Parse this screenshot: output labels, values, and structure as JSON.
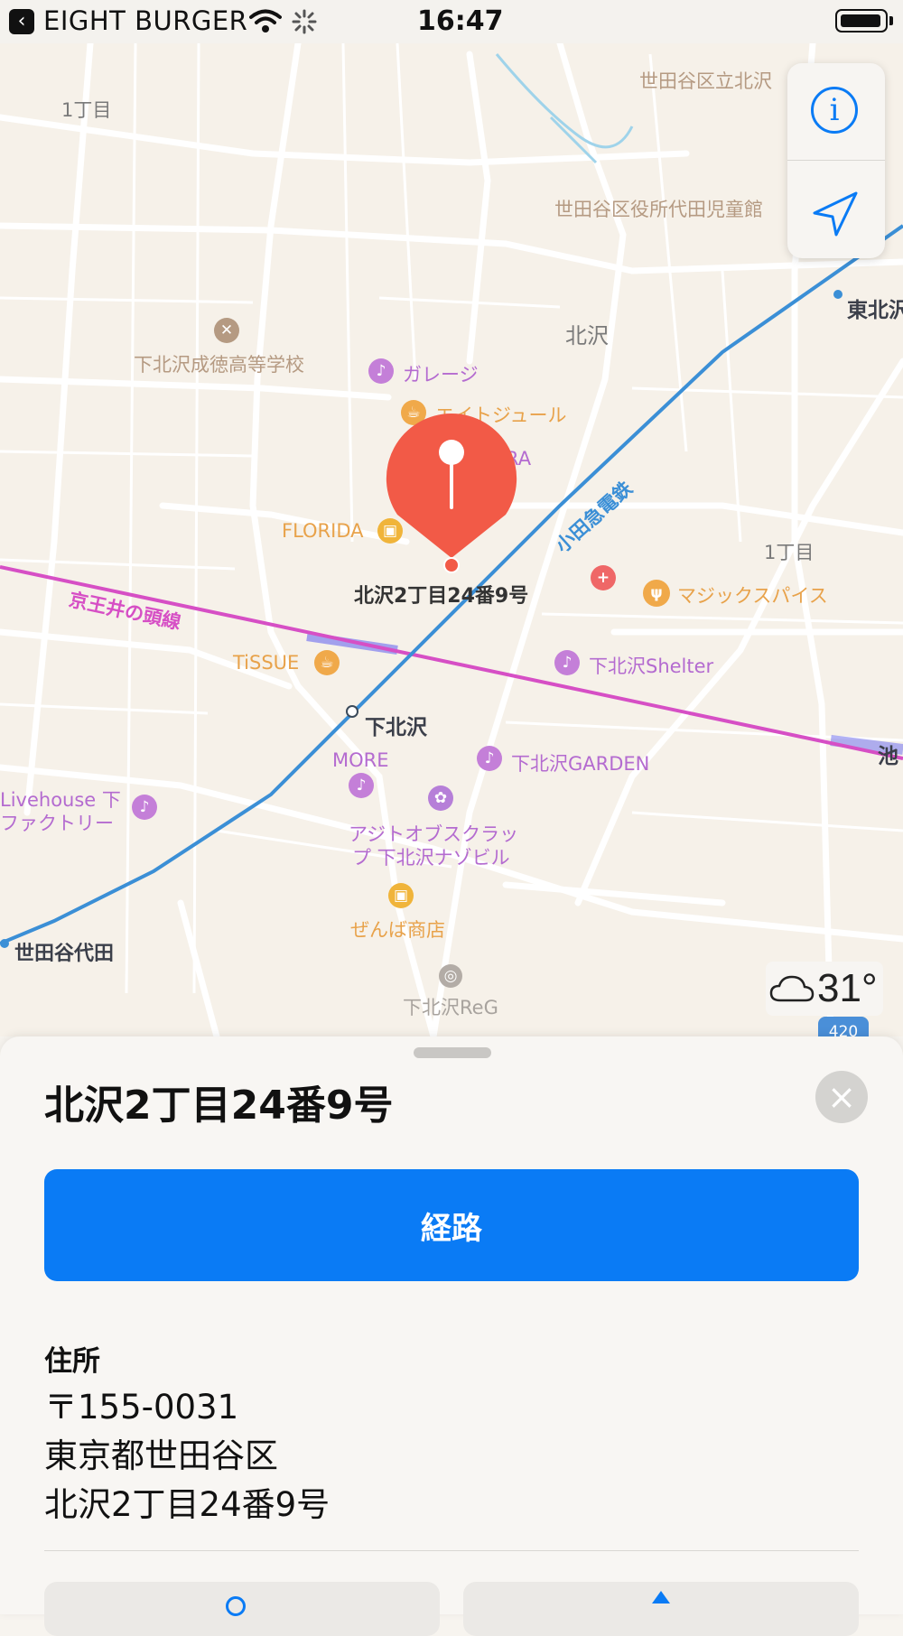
{
  "status_bar": {
    "back_app": "EIGHT BURGER",
    "time": "16:47"
  },
  "map": {
    "labels": {
      "block_1chome_left": "1丁目",
      "block_1chome_right": "1丁目",
      "school_top": "世田谷区立北沢",
      "children_hall": "世田谷区役所代田児童館",
      "kitazawa": "北沢",
      "higashikitazawa": "東北沢",
      "seitoku": "下北沢成徳高等学校",
      "garage": "ガレージ",
      "eightjour": "エイトジュール",
      "ra": "RA",
      "florida": "FLORIDA",
      "magic_spice": "マジックスパイス",
      "tissue": "TiSSUE",
      "shelter": "下北沢Shelter",
      "shimokitazawa": "下北沢",
      "more": "MORE",
      "garden": "下北沢GARDEN",
      "livehouse_1": "Livehouse 下",
      "livehouse_2": "ファクトリー",
      "ajito_1": "アジトオブスクラッ",
      "ajito_2": "プ 下北沢ナゾビル",
      "zenba": "ぜんば商店",
      "setagaya_daita": "世田谷代田",
      "reg": "下北沢ReG",
      "ike": "池",
      "keio_line": "京王井の頭線",
      "odakyu_line": "小田急電鉄",
      "pin_label": "北沢2丁目24番9号"
    },
    "weather_temp": "31°",
    "route_shield": "420",
    "accent_pin": "#f25a47",
    "keio_color": "#d64fc5",
    "odakyu_color": "#3b8fd6"
  },
  "sheet": {
    "title": "北沢2丁目24番9号",
    "route_button": "経路",
    "address_heading": "住所",
    "address_lines": [
      "〒155-0031",
      "東京都世田谷区",
      "北沢2丁目24番9号"
    ],
    "accent": "#0a7bf5"
  }
}
